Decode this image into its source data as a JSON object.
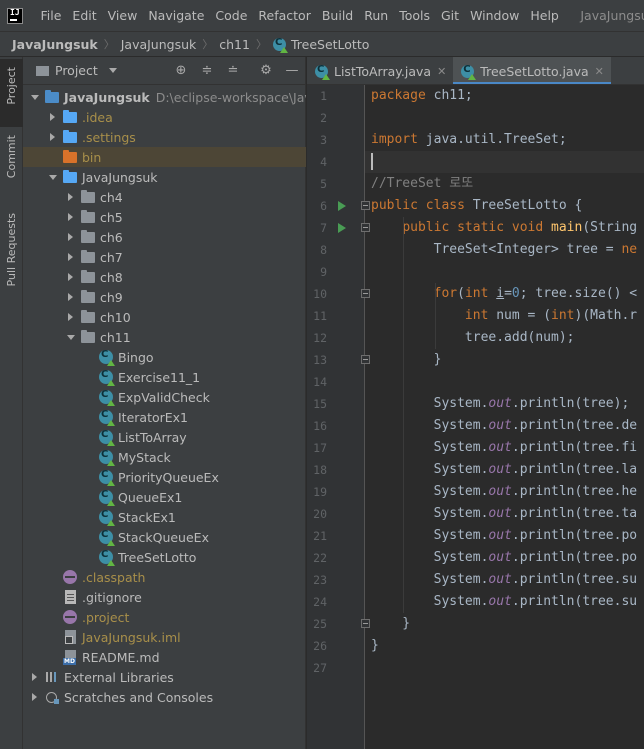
{
  "menubar": {
    "items": [
      "File",
      "Edit",
      "View",
      "Navigate",
      "Code",
      "Refactor",
      "Build",
      "Run",
      "Tools",
      "Git",
      "Window",
      "Help"
    ],
    "window_title": "JavaJungsuk - TreeSe"
  },
  "breadcrumb": [
    "JavaJungsuk",
    "JavaJungsuk",
    "ch11",
    "TreeSetLotto"
  ],
  "tool_strip": {
    "tabs": [
      "Project",
      "Commit",
      "Pull Requests"
    ]
  },
  "project_panel": {
    "title": "Project",
    "tree": [
      {
        "label": "JavaJungsuk",
        "path": "D:\\eclipse-workspace\\JavaJun",
        "icon": "module-folder-icon",
        "arrow": "down",
        "depth": 0
      },
      {
        "label": ".idea",
        "icon": "folder-icon",
        "arrow": "right",
        "depth": 1,
        "style": "ignored"
      },
      {
        "label": ".settings",
        "icon": "folder-icon",
        "arrow": "right",
        "depth": 1,
        "style": "ignored"
      },
      {
        "label": "bin",
        "icon": "excluded-folder-icon",
        "arrow": "none",
        "depth": 1,
        "style": "ignored",
        "highlight": true
      },
      {
        "label": "JavaJungsuk",
        "icon": "source-folder-icon",
        "arrow": "down",
        "depth": 1
      },
      {
        "label": "ch4",
        "icon": "package-icon",
        "arrow": "right",
        "depth": 2
      },
      {
        "label": "ch5",
        "icon": "package-icon",
        "arrow": "right",
        "depth": 2
      },
      {
        "label": "ch6",
        "icon": "package-icon",
        "arrow": "right",
        "depth": 2
      },
      {
        "label": "ch7",
        "icon": "package-icon",
        "arrow": "right",
        "depth": 2
      },
      {
        "label": "ch8",
        "icon": "package-icon",
        "arrow": "right",
        "depth": 2
      },
      {
        "label": "ch9",
        "icon": "package-icon",
        "arrow": "right",
        "depth": 2
      },
      {
        "label": "ch10",
        "icon": "package-icon",
        "arrow": "right",
        "depth": 2
      },
      {
        "label": "ch11",
        "icon": "package-icon",
        "arrow": "down",
        "depth": 2
      },
      {
        "label": "Bingo",
        "icon": "java-class-icon",
        "arrow": "none",
        "depth": 3
      },
      {
        "label": "Exercise11_1",
        "icon": "java-class-icon",
        "arrow": "none",
        "depth": 3
      },
      {
        "label": "ExpValidCheck",
        "icon": "java-class-icon",
        "arrow": "none",
        "depth": 3
      },
      {
        "label": "IteratorEx1",
        "icon": "java-class-icon",
        "arrow": "none",
        "depth": 3
      },
      {
        "label": "ListToArray",
        "icon": "java-class-icon",
        "arrow": "none",
        "depth": 3
      },
      {
        "label": "MyStack",
        "icon": "java-class-icon",
        "arrow": "none",
        "depth": 3
      },
      {
        "label": "PriorityQueueEx",
        "icon": "java-class-icon",
        "arrow": "none",
        "depth": 3
      },
      {
        "label": "QueueEx1",
        "icon": "java-class-icon",
        "arrow": "none",
        "depth": 3
      },
      {
        "label": "StackEx1",
        "icon": "java-class-icon",
        "arrow": "none",
        "depth": 3
      },
      {
        "label": "StackQueueEx",
        "icon": "java-class-icon",
        "arrow": "none",
        "depth": 3
      },
      {
        "label": "TreeSetLotto",
        "icon": "java-class-icon",
        "arrow": "none",
        "depth": 3
      },
      {
        "label": ".classpath",
        "icon": "classpath-file-icon",
        "arrow": "none",
        "depth": 1,
        "style": "ignored"
      },
      {
        "label": ".gitignore",
        "icon": "text-file-icon",
        "arrow": "none",
        "depth": 1
      },
      {
        "label": ".project",
        "icon": "classpath-file-icon",
        "arrow": "none",
        "depth": 1,
        "style": "ignored"
      },
      {
        "label": "JavaJungsuk.iml",
        "icon": "iml-file-icon",
        "arrow": "none",
        "depth": 1,
        "style": "ignored"
      },
      {
        "label": "README.md",
        "icon": "markdown-file-icon",
        "arrow": "none",
        "depth": 1
      },
      {
        "label": "External Libraries",
        "icon": "library-icon",
        "arrow": "right",
        "depth": 0
      },
      {
        "label": "Scratches and Consoles",
        "icon": "scratches-icon",
        "arrow": "right",
        "depth": 0
      }
    ]
  },
  "editor": {
    "tabs": [
      {
        "label": "ListToArray.java",
        "active": false
      },
      {
        "label": "TreeSetLotto.java",
        "active": true
      }
    ],
    "current_line": 4,
    "run_lines": [
      6,
      7
    ],
    "fold_lines": [
      6,
      7,
      10,
      13,
      25
    ],
    "lines": [
      [
        [
          "kw",
          "package"
        ],
        [
          "",
          " ch11;"
        ]
      ],
      [],
      [
        [
          "kw",
          "import"
        ],
        [
          "",
          " java.util.TreeSet;"
        ]
      ],
      [],
      [
        [
          "cm",
          "//TreeSet 로또"
        ]
      ],
      [
        [
          "kw",
          "public class"
        ],
        [
          "",
          " TreeSetLotto {"
        ]
      ],
      [
        [
          "",
          "    "
        ],
        [
          "kw",
          "public static void"
        ],
        [
          "",
          " "
        ],
        [
          "fn",
          "main"
        ],
        [
          "",
          "(String"
        ]
      ],
      [
        [
          "",
          "        TreeSet<Integer> tree = "
        ],
        [
          "kw",
          "ne"
        ]
      ],
      [],
      [
        [
          "",
          "        "
        ],
        [
          "kw",
          "for"
        ],
        [
          "",
          "("
        ],
        [
          "kw",
          "int"
        ],
        [
          "",
          " "
        ],
        [
          "var",
          "i"
        ],
        [
          "",
          "="
        ],
        [
          "num",
          "0"
        ],
        [
          "",
          "; tree.size() <"
        ]
      ],
      [
        [
          "",
          "            "
        ],
        [
          "kw",
          "int"
        ],
        [
          "",
          " num = ("
        ],
        [
          "kw",
          "int"
        ],
        [
          "",
          ")(Math.r"
        ]
      ],
      [
        [
          "",
          "            tree.add(num);"
        ]
      ],
      [
        [
          "",
          "        }"
        ]
      ],
      [],
      [
        [
          "",
          "        System."
        ],
        [
          "fld",
          "out"
        ],
        [
          "",
          ".println(tree);"
        ]
      ],
      [
        [
          "",
          "        System."
        ],
        [
          "fld",
          "out"
        ],
        [
          "",
          ".println(tree.de"
        ]
      ],
      [
        [
          "",
          "        System."
        ],
        [
          "fld",
          "out"
        ],
        [
          "",
          ".println(tree.fi"
        ]
      ],
      [
        [
          "",
          "        System."
        ],
        [
          "fld",
          "out"
        ],
        [
          "",
          ".println(tree.la"
        ]
      ],
      [
        [
          "",
          "        System."
        ],
        [
          "fld",
          "out"
        ],
        [
          "",
          ".println(tree.he"
        ]
      ],
      [
        [
          "",
          "        System."
        ],
        [
          "fld",
          "out"
        ],
        [
          "",
          ".println(tree.ta"
        ]
      ],
      [
        [
          "",
          "        System."
        ],
        [
          "fld",
          "out"
        ],
        [
          "",
          ".println(tree.po"
        ]
      ],
      [
        [
          "",
          "        System."
        ],
        [
          "fld",
          "out"
        ],
        [
          "",
          ".println(tree.po"
        ]
      ],
      [
        [
          "",
          "        System."
        ],
        [
          "fld",
          "out"
        ],
        [
          "",
          ".println(tree.su"
        ]
      ],
      [
        [
          "",
          "        System."
        ],
        [
          "fld",
          "out"
        ],
        [
          "",
          ".println(tree.su"
        ]
      ],
      [
        [
          "",
          "    }"
        ]
      ],
      [
        [
          "",
          "}"
        ]
      ],
      []
    ]
  },
  "colors": {
    "keyword": "#cc7832",
    "comment": "#808080",
    "static_field": "#9876aa",
    "method": "#ffc66d",
    "number": "#6897bb",
    "accent": "#4a88c7",
    "run_icon": "#499c54"
  }
}
